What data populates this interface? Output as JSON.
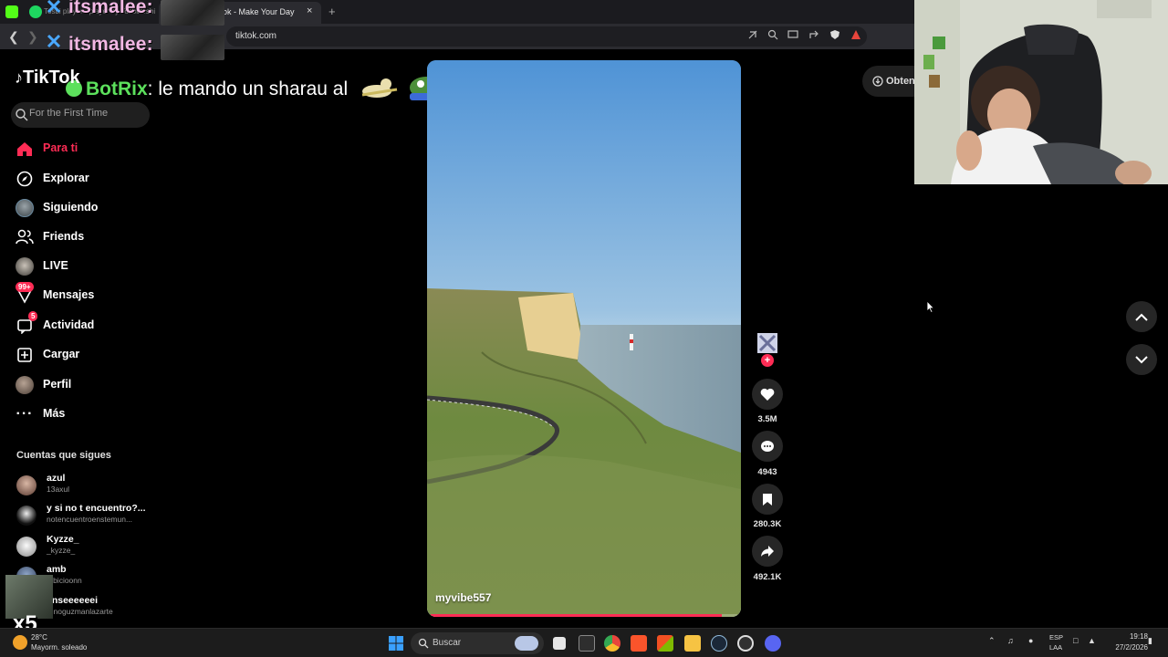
{
  "browser": {
    "tabs": [
      {
        "label": "Tosbi player - player by Tosbi/tosbi",
        "active": false
      },
      {
        "label": "ok - Make Your Day",
        "active": true
      }
    ],
    "close_tab_glyph": "×",
    "new_tab_glyph": "+",
    "url": "tiktok.com"
  },
  "stream_overlay": {
    "chat": [
      {
        "user": "itsmalee:"
      },
      {
        "user": "itsmalee:"
      }
    ],
    "bot_user": "BotRix",
    "bot_sep": ": ",
    "bot_message": "le mando un sharau al",
    "combo_label": "x5"
  },
  "tiktok": {
    "logo_text": "TikTok",
    "search": {
      "placeholder": "For the First Time"
    },
    "nav": [
      {
        "label": "Para ti",
        "icon": "home-icon",
        "active": true
      },
      {
        "label": "Explorar",
        "icon": "compass-icon"
      },
      {
        "label": "Siguiendo",
        "icon": "following-avatar"
      },
      {
        "label": "Friends",
        "icon": "friends-icon"
      },
      {
        "label": "LIVE",
        "icon": "live-avatar"
      },
      {
        "label": "Mensajes",
        "icon": "messages-icon",
        "badge": "99+"
      },
      {
        "label": "Actividad",
        "icon": "activity-icon",
        "badge": "5"
      },
      {
        "label": "Cargar",
        "icon": "upload-icon"
      },
      {
        "label": "Perfil",
        "icon": "profile-avatar"
      },
      {
        "label": "Más",
        "icon": "more-icon"
      }
    ],
    "following_title": "Cuentas que sigues",
    "accounts": [
      {
        "name": "azul",
        "handle": "13axul"
      },
      {
        "name": "y si no t encuentro?...",
        "handle": "notencuentroenstemun..."
      },
      {
        "name": "Kyzze_",
        "handle": "_kyzze_"
      },
      {
        "name": "amb",
        "handle": "mbicioonn"
      },
      {
        "name": "enseeeeeei",
        "handle": "runoguzmanlazarte"
      }
    ],
    "video": {
      "author": "myvibe557",
      "progress": 0.95
    },
    "actions": {
      "likes": "3.5M",
      "comments": "4943",
      "saves": "280.3K",
      "shares": "492.1K"
    },
    "get_app_label": "Obten"
  },
  "taskbar": {
    "weather_temp": "28°C",
    "weather_desc": "Mayorm. soleado",
    "search_label": "Buscar",
    "lang_top": "ESP",
    "lang_bottom": "LAA",
    "time": "19:18",
    "date": "27/2/2026"
  },
  "colors": {
    "accent": "#fe2c55",
    "bot_name": "#5ce05c",
    "chat_name": "#f2b8e4"
  }
}
